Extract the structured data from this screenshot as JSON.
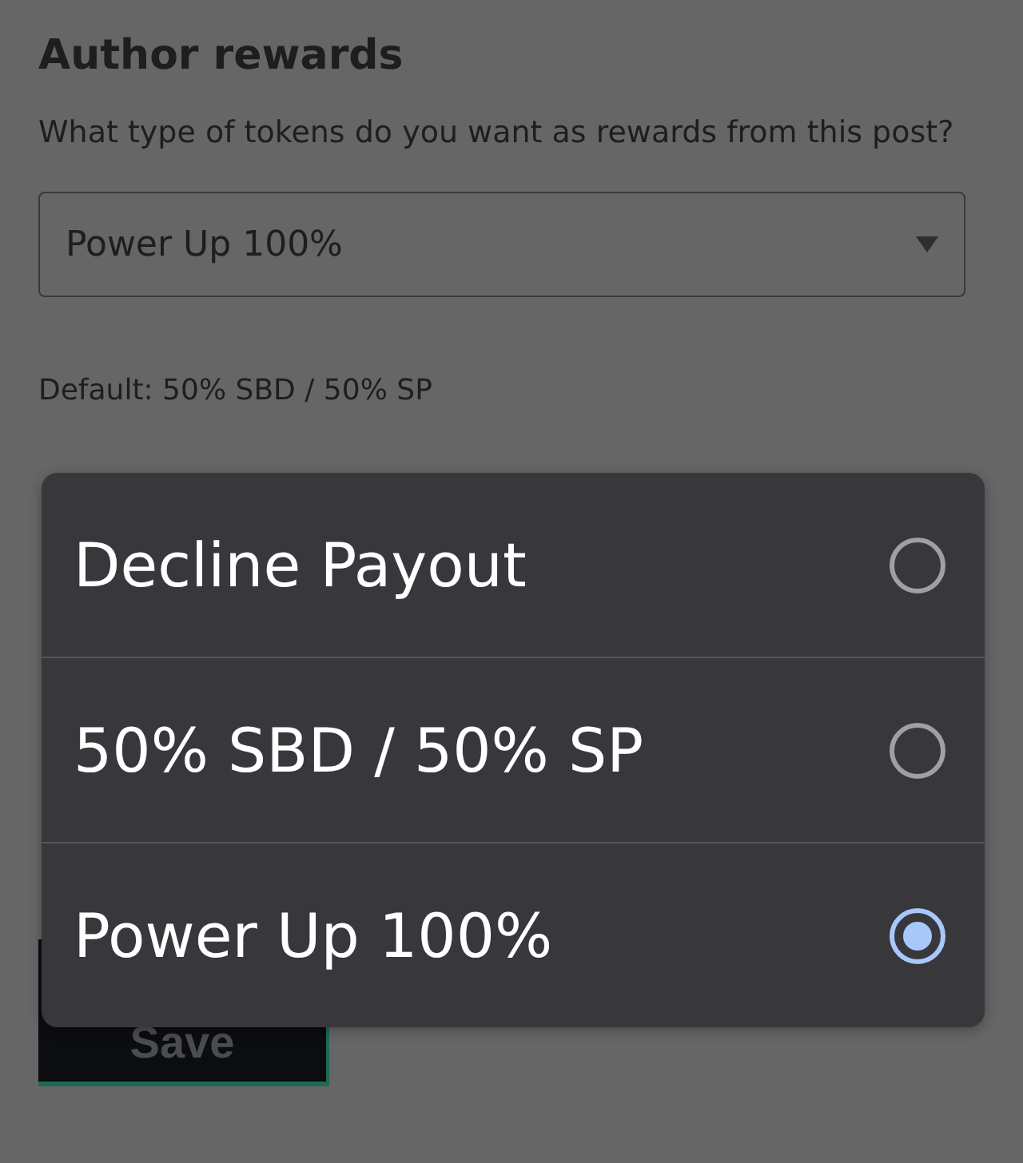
{
  "section": {
    "title": "Author rewards",
    "question": "What type of tokens do you want as rewards from this post?",
    "select": {
      "value": "Power Up 100%"
    },
    "default_note": "Default: 50% SBD / 50% SP"
  },
  "save_button": {
    "label": "Save"
  },
  "menu": {
    "options": [
      {
        "label": "Decline Payout",
        "selected": false
      },
      {
        "label": "50% SBD / 50% SP",
        "selected": false
      },
      {
        "label": "Power Up 100%",
        "selected": true
      }
    ]
  }
}
